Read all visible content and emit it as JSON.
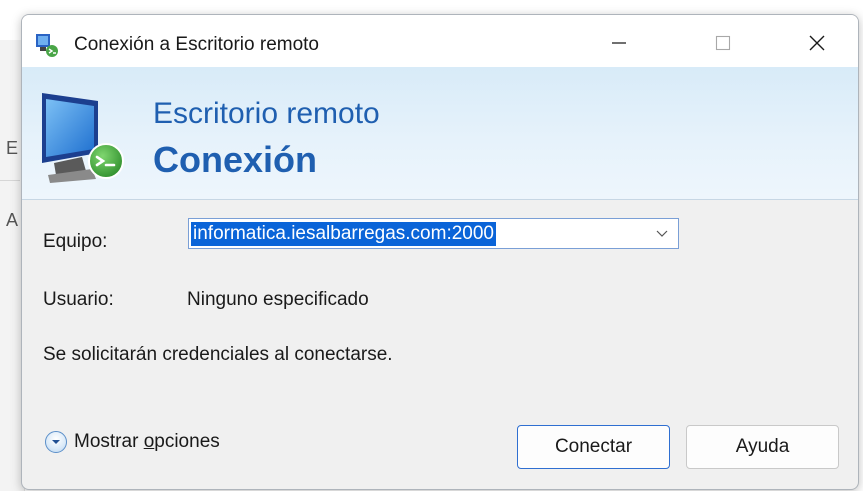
{
  "window": {
    "title": "Conexión a Escritorio remoto",
    "controls": {
      "minimize": "minimize-icon",
      "maximize": "maximize-icon",
      "close": "close-icon"
    }
  },
  "banner": {
    "line1": "Escritorio remoto",
    "line2": "Conexión"
  },
  "form": {
    "equipo_label": "Equipo:",
    "equipo_value": "informatica.iesalbarregas.com:2000",
    "usuario_label": "Usuario:",
    "usuario_value": "Ninguno especificado",
    "message": "Se solicitarán credenciales al conectarse."
  },
  "options": {
    "label_prefix": "Mostrar ",
    "label_access": "o",
    "label_suffix": "pciones"
  },
  "buttons": {
    "connect": "Conectar",
    "help": "Ayuda"
  },
  "background": {
    "letter_e": "E",
    "letter_a": "A"
  },
  "colors": {
    "accent": "#1f5fb0",
    "selection": "#0a64d8"
  }
}
